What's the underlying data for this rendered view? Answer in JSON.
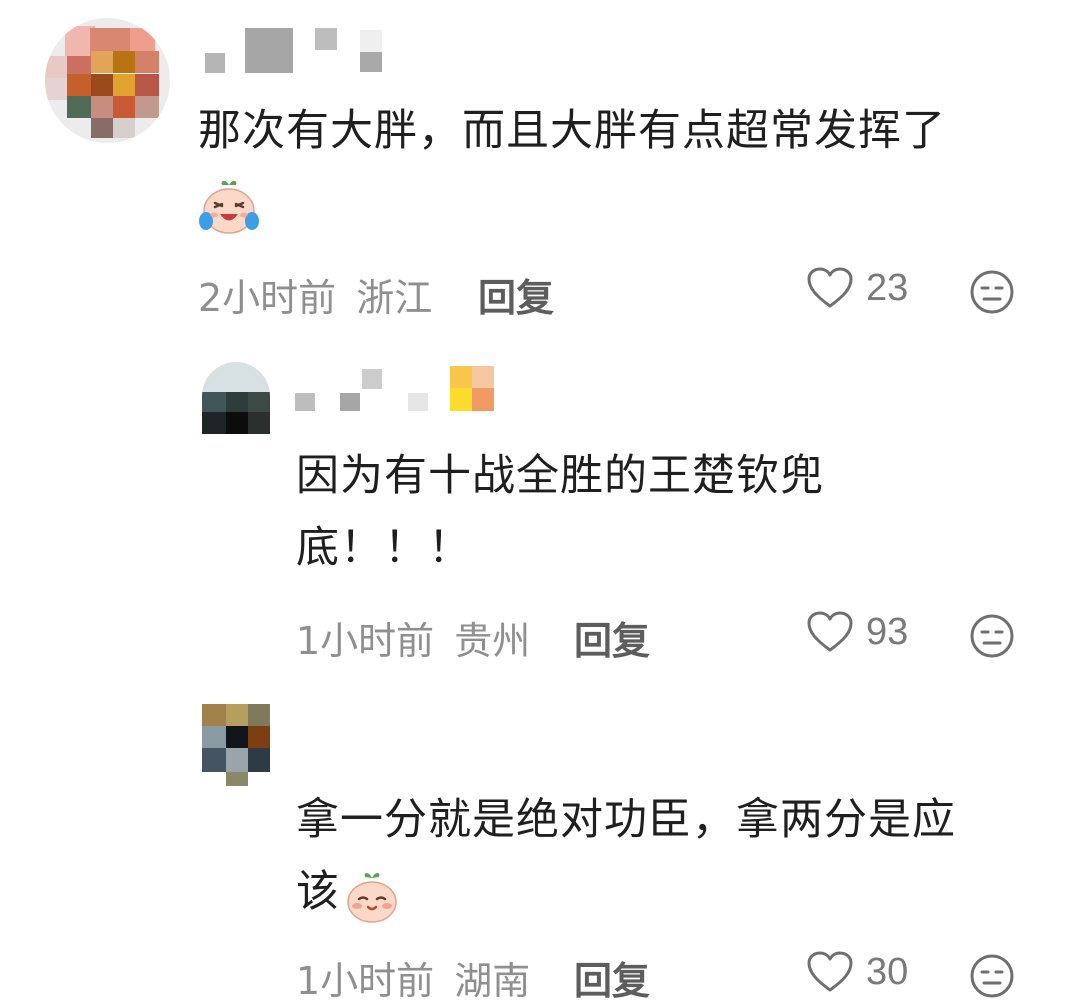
{
  "comments": [
    {
      "text_line1": "那次有大胖，而且大胖有点超常发挥了",
      "emoji": "laugh-cry-emoji",
      "time": "2小时前",
      "location": "浙江",
      "reply_label": "回复",
      "likes": "23"
    },
    {
      "text_line1": "因为有十战全胜的王楚钦兜",
      "text_line2": "底！！！",
      "time": "1小时前",
      "location": "贵州",
      "reply_label": "回复",
      "likes": "93"
    },
    {
      "text_line1": "拿一分就是绝对功臣，拿两分是应",
      "text_line2": "该",
      "emoji": "blush-emoji",
      "time": "1小时前",
      "location": "湖南",
      "reply_label": "回复",
      "likes": "30"
    }
  ],
  "icons": {
    "like": "heart-outline-icon",
    "dislike": "neutral-face-icon"
  },
  "colors": {
    "text": "#1f1f1f",
    "meta": "#8f8f8f",
    "reply": "#5d5d5d",
    "icon": "#6f6f6f"
  }
}
